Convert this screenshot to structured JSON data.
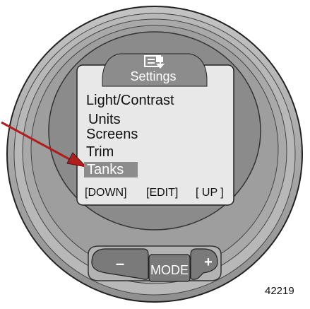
{
  "screen": {
    "header_icon": "settings-menu-icon",
    "title": "Settings",
    "menu_items": [
      "Light/Contrast",
      "Units",
      "Screens",
      "Trim",
      "Tanks"
    ],
    "selected_item": "Tanks",
    "softkeys": {
      "down": "[DOWN]",
      "edit": "[EDIT]",
      "up": "[ UP ]"
    }
  },
  "buttons": {
    "minus": "–",
    "mode": "MODE",
    "plus": "+"
  },
  "callout": {
    "arrow_color": "#b01e1e"
  },
  "reference_number": "42219",
  "colors": {
    "bezel": "#a6a6a6",
    "screen_background": "#e8e8e8",
    "header_tab": "#8c8c8c",
    "button_fill": "#7a7a7a"
  }
}
